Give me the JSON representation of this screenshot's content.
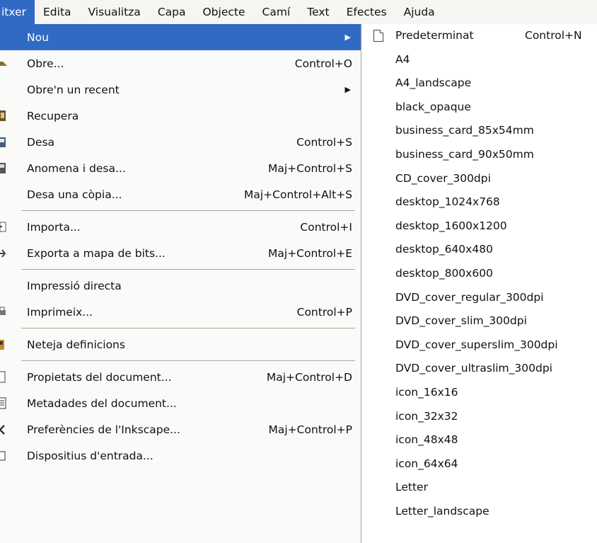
{
  "menubar": [
    "itxer",
    "Edita",
    "Visualitza",
    "Capa",
    "Objecte",
    "Camí",
    "Text",
    "Efectes",
    "Ajuda"
  ],
  "file_menu": {
    "items": [
      {
        "label": "Nou",
        "shortcut": "",
        "submenu": true,
        "icon": "none",
        "highlight": true
      },
      {
        "label": "Obre...",
        "shortcut": "Control+O",
        "submenu": false,
        "icon": "folder-open-icon"
      },
      {
        "label": "Obre'n un recent",
        "shortcut": "",
        "submenu": true,
        "icon": "none"
      },
      {
        "label": "Recupera",
        "shortcut": "",
        "submenu": false,
        "icon": "revert-icon"
      },
      {
        "label": "Desa",
        "shortcut": "Control+S",
        "submenu": false,
        "icon": "save-icon"
      },
      {
        "label": "Anomena i desa...",
        "shortcut": "Maj+Control+S",
        "submenu": false,
        "icon": "save-as-icon"
      },
      {
        "label": "Desa una còpia...",
        "shortcut": "Maj+Control+Alt+S",
        "submenu": false,
        "icon": "none"
      },
      {
        "sep": true
      },
      {
        "label": "Importa...",
        "shortcut": "Control+I",
        "submenu": false,
        "icon": "import-icon"
      },
      {
        "label": "Exporta a mapa de bits...",
        "shortcut": "Maj+Control+E",
        "submenu": false,
        "icon": "export-icon"
      },
      {
        "sep": true
      },
      {
        "label": "Impressió directa",
        "shortcut": "",
        "submenu": false,
        "icon": "none"
      },
      {
        "label": "Imprimeix...",
        "shortcut": "Control+P",
        "submenu": false,
        "icon": "print-icon"
      },
      {
        "sep": true
      },
      {
        "label": "Neteja definicions",
        "shortcut": "",
        "submenu": false,
        "icon": "vacuum-icon"
      },
      {
        "sep": true
      },
      {
        "label": "Propietats del document...",
        "shortcut": "Maj+Control+D",
        "submenu": false,
        "icon": "document-properties-icon"
      },
      {
        "label": "Metadades del document...",
        "shortcut": "",
        "submenu": false,
        "icon": "metadata-icon"
      },
      {
        "label": "Preferències de l'Inkscape...",
        "shortcut": "Maj+Control+P",
        "submenu": false,
        "icon": "preferences-icon"
      },
      {
        "label": "Dispositius d'entrada...",
        "shortcut": "",
        "submenu": false,
        "icon": "input-devices-icon"
      }
    ]
  },
  "new_submenu": {
    "items": [
      {
        "label": "Predeterminat",
        "shortcut": "Control+N",
        "icon": "document-icon"
      },
      {
        "label": "A4"
      },
      {
        "label": "A4_landscape"
      },
      {
        "label": "black_opaque"
      },
      {
        "label": "business_card_85x54mm"
      },
      {
        "label": "business_card_90x50mm"
      },
      {
        "label": "CD_cover_300dpi"
      },
      {
        "label": "desktop_1024x768"
      },
      {
        "label": "desktop_1600x1200"
      },
      {
        "label": "desktop_640x480"
      },
      {
        "label": "desktop_800x600"
      },
      {
        "label": "DVD_cover_regular_300dpi"
      },
      {
        "label": "DVD_cover_slim_300dpi"
      },
      {
        "label": "DVD_cover_superslim_300dpi"
      },
      {
        "label": "DVD_cover_ultraslim_300dpi"
      },
      {
        "label": "icon_16x16"
      },
      {
        "label": "icon_32x32"
      },
      {
        "label": "icon_48x48"
      },
      {
        "label": "icon_64x64"
      },
      {
        "label": "Letter"
      },
      {
        "label": "Letter_landscape"
      }
    ]
  },
  "colors": {
    "highlight": "#316ac5",
    "menu_bg": "#fafaf8",
    "menubar_bg": "#f6f5f1"
  }
}
